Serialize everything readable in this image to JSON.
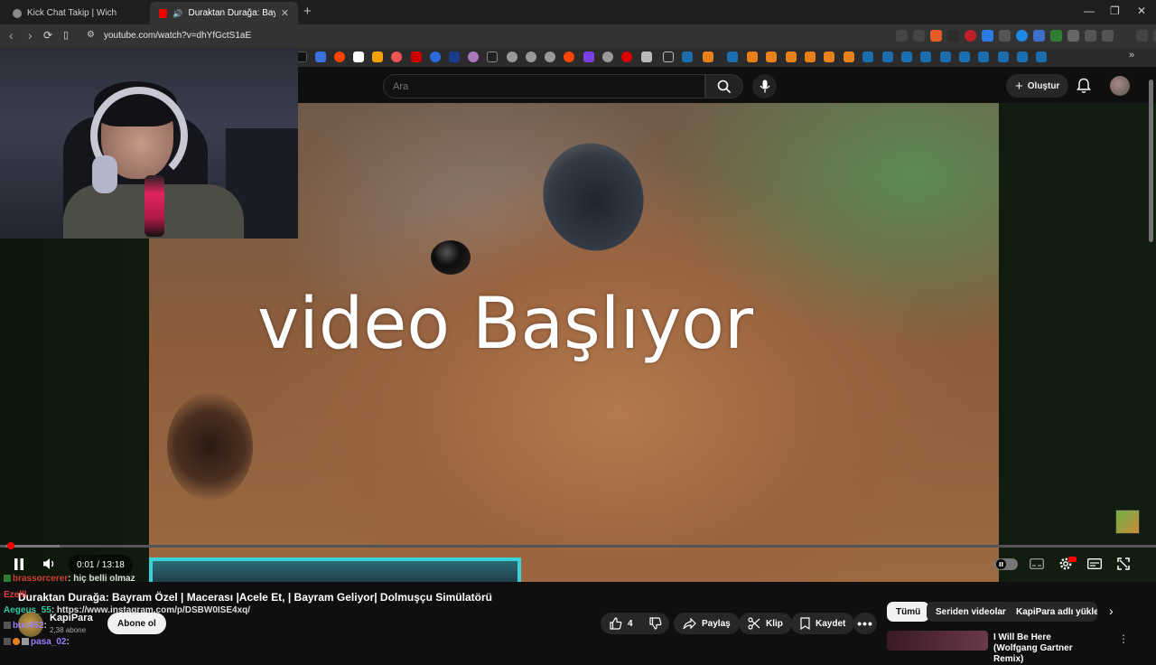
{
  "browser": {
    "tabs": [
      {
        "title": "Kick Chat Takip | Wich",
        "active": false
      },
      {
        "title": "Duraktan Durağa: Bayram Öz",
        "active": true
      }
    ],
    "url": "youtube.com/watch?v=dhYfGctS1aE"
  },
  "youtube": {
    "search_placeholder": "Ara",
    "create_label": "Oluştur"
  },
  "video": {
    "overlay_text": "video Başlıyor",
    "time": "0:01 / 13:18",
    "progress_fraction": 0.0013,
    "title": "Duraktan Durağa: Bayram Özel | Macerası |Acele Et, | Bayram Geliyor| Dolmuşçu Simülatörü"
  },
  "channel": {
    "name": "KapiPara",
    "subscribers": "2,38 abone",
    "subscribe_label": "Abone ol"
  },
  "actions": {
    "like_count": "4",
    "share_label": "Paylaş",
    "clip_label": "Klip",
    "save_label": "Kaydet"
  },
  "chips": [
    {
      "label": "Tümü",
      "active": true
    },
    {
      "label": "Seriden videolar",
      "active": false
    },
    {
      "label": "KapiPara adlı yükleyic",
      "active": false
    }
  ],
  "recommendation": {
    "title": "I Will Be Here (Wolfgang Gartner Remix)"
  },
  "chat": [
    {
      "user": "brassorcerer",
      "message": ": hiç belli olmaz",
      "color": "#d33b3b"
    },
    {
      "user": "Ezelll",
      "message": "",
      "color": "#e04040"
    },
    {
      "user": "Aegeus_55",
      "message": ": https://www.instagram.com/p/DSBW0ISE4xq/",
      "color": "#2fc9a5"
    },
    {
      "user": "buc452",
      "message": ":",
      "color": "#9a7cff"
    },
    {
      "user": "pasa_02",
      "message": ":",
      "color": "#9a7cff"
    }
  ],
  "colors": {
    "accent_red": "#ff0000",
    "chip_active_bg": "#f1f1f1",
    "overlay_bar": "#3ad1d8"
  }
}
